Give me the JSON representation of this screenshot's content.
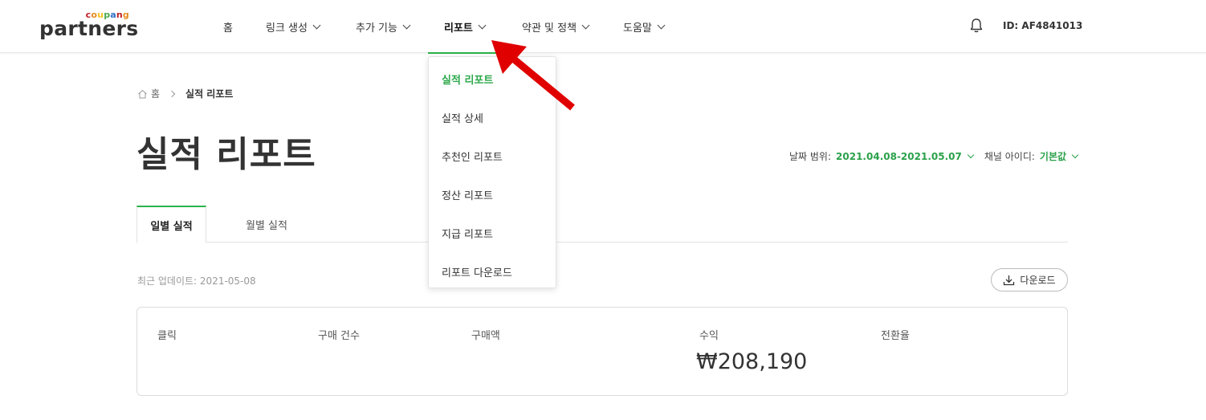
{
  "header": {
    "logo": {
      "small": "coupang",
      "big": "partners"
    },
    "brand_colors": [
      "#c02126",
      "#e58a1f",
      "#f4c321",
      "#4aa84a",
      "#2f6fc7"
    ],
    "nav": [
      {
        "label": "홈",
        "has_chevron": false
      },
      {
        "label": "링크 생성",
        "has_chevron": true
      },
      {
        "label": "추가 기능",
        "has_chevron": true
      },
      {
        "label": "리포트",
        "has_chevron": true,
        "active": true
      },
      {
        "label": "약관 및 정책",
        "has_chevron": true
      },
      {
        "label": "도움말",
        "has_chevron": true
      }
    ],
    "user_id": "ID: AF4841013"
  },
  "dropdown": {
    "items": [
      {
        "label": "실적 리포트",
        "active": true
      },
      {
        "label": "실적 상세"
      },
      {
        "label": "추천인 리포트"
      },
      {
        "label": "정산 리포트"
      },
      {
        "label": "지급 리포트"
      },
      {
        "label": "리포트 다운로드"
      }
    ]
  },
  "breadcrumb": {
    "home": "홈",
    "current": "실적 리포트"
  },
  "page_title": "실적 리포트",
  "filters": {
    "date_label": "날짜 범위:",
    "date_value": "2021.04.08-2021.05.07",
    "channel_label": "채널 아이디:",
    "channel_value": "기본값"
  },
  "tabs": [
    {
      "label": "일별 실적",
      "active": true
    },
    {
      "label": "월별 실적"
    }
  ],
  "updated": "최근 업데이트: 2021-05-08",
  "download_label": "다운로드",
  "stats": [
    {
      "label": "클릭",
      "value": ""
    },
    {
      "label": "구매 건수",
      "value": ""
    },
    {
      "label": "구매액",
      "value": ""
    },
    {
      "label": "수익",
      "value": "₩208,190"
    },
    {
      "label": "전환율",
      "value": ""
    }
  ],
  "colors": {
    "accent": "#2cb34a",
    "annotation_arrow": "#e00000"
  }
}
